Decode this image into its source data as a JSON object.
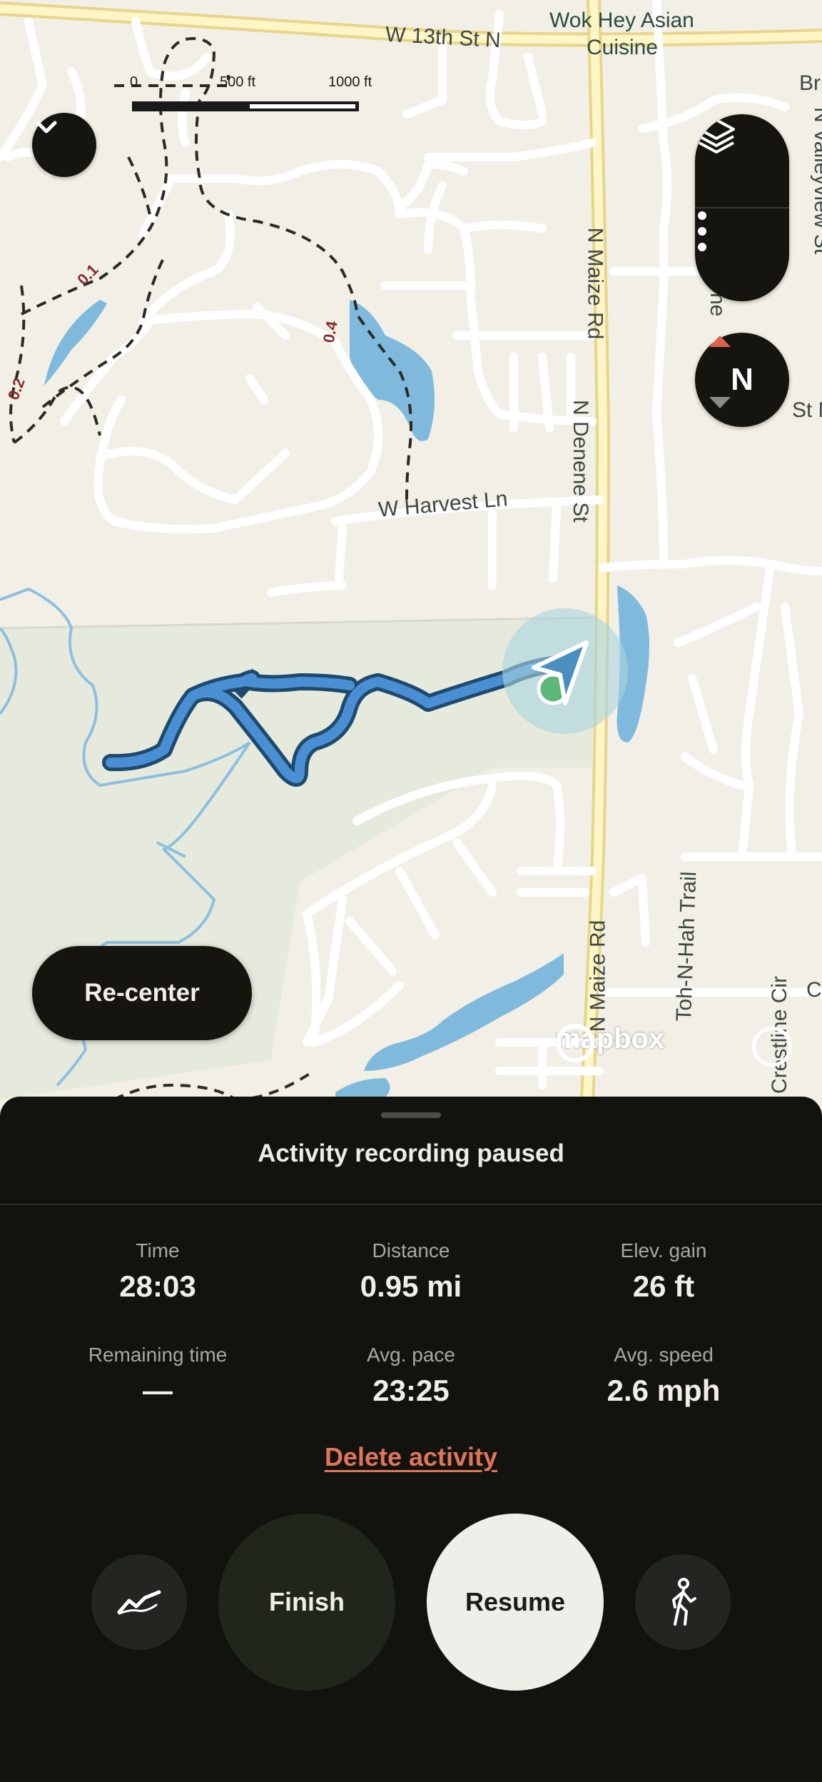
{
  "map": {
    "poi_line1": "Wok Hey Asian",
    "poi_line2": "Cuisine",
    "streets": {
      "w13th": "W 13th St N",
      "harvest": "W Harvest Ln",
      "maize_top": "N Maize Rd",
      "maize_bottom": "N Maize Rd",
      "denene": "N Denene St",
      "valleyview": "N Valleyview St",
      "tohnhah": "Toh-N-Hah Trail",
      "crestline": "Crestline Cir",
      "br_partial": "Br",
      "stn_partial": "St N",
      "ne_partial": "ne",
      "c_partial": "C"
    },
    "trail_markers": [
      "0.1",
      "0.2",
      "0.4"
    ],
    "scale": {
      "zero": "0",
      "mid": "500 ft",
      "end": "1000 ft"
    },
    "attribution": "mapbox",
    "compass_letter": "N"
  },
  "controls": {
    "recenter_label": "Re-center",
    "collapse_icon": "chevron-down-icon",
    "layers_icon": "layers-icon",
    "more_icon": "more-vertical-icon"
  },
  "sheet": {
    "status_title": "Activity recording paused",
    "stats": [
      {
        "label": "Time",
        "value": "28:03"
      },
      {
        "label": "Distance",
        "value": "0.95 mi"
      },
      {
        "label": "Elev. gain",
        "value": "26 ft"
      },
      {
        "label": "Remaining time",
        "value": "—"
      },
      {
        "label": "Avg. pace",
        "value": "23:25"
      },
      {
        "label": "Avg. speed",
        "value": "2.6 mph"
      }
    ],
    "delete_label": "Delete activity",
    "finish_label": "Finish",
    "resume_label": "Resume",
    "stats_icon": "elevation-chart-icon",
    "activity_icon": "hiking-person-icon"
  },
  "colors": {
    "sheet_bg": "#12130f",
    "accent_red": "#e0755a",
    "route_blue": "#4a8fd3",
    "map_bg": "#f2efe6",
    "park_green": "#e6eadc",
    "water": "#7fbadc"
  }
}
